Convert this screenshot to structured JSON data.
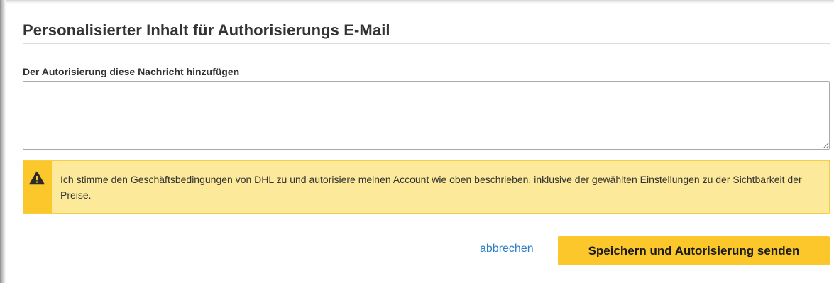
{
  "section": {
    "title": "Personalisierter Inhalt für Authorisierungs E-Mail"
  },
  "message_field": {
    "label": "Der Autorisierung diese Nachricht hinzufügen",
    "value": "",
    "placeholder": ""
  },
  "notice": {
    "icon": "warning-icon",
    "text": "Ich stimme den Geschäftsbedingungen von DHL zu und autorisiere meinen Account wie oben beschrieben, inklusive der gewählten Einstellungen zu der Sichtbarkeit der Preise.",
    "colors": {
      "background": "#fde99a",
      "stripe": "#fcc72b",
      "border": "#f5cd47"
    }
  },
  "actions": {
    "cancel_label": "abbrechen",
    "submit_label": "Speichern und Autorisierung senden"
  },
  "colors": {
    "accent": "#fcc72b",
    "link": "#2e7ec5",
    "text": "#333333"
  }
}
